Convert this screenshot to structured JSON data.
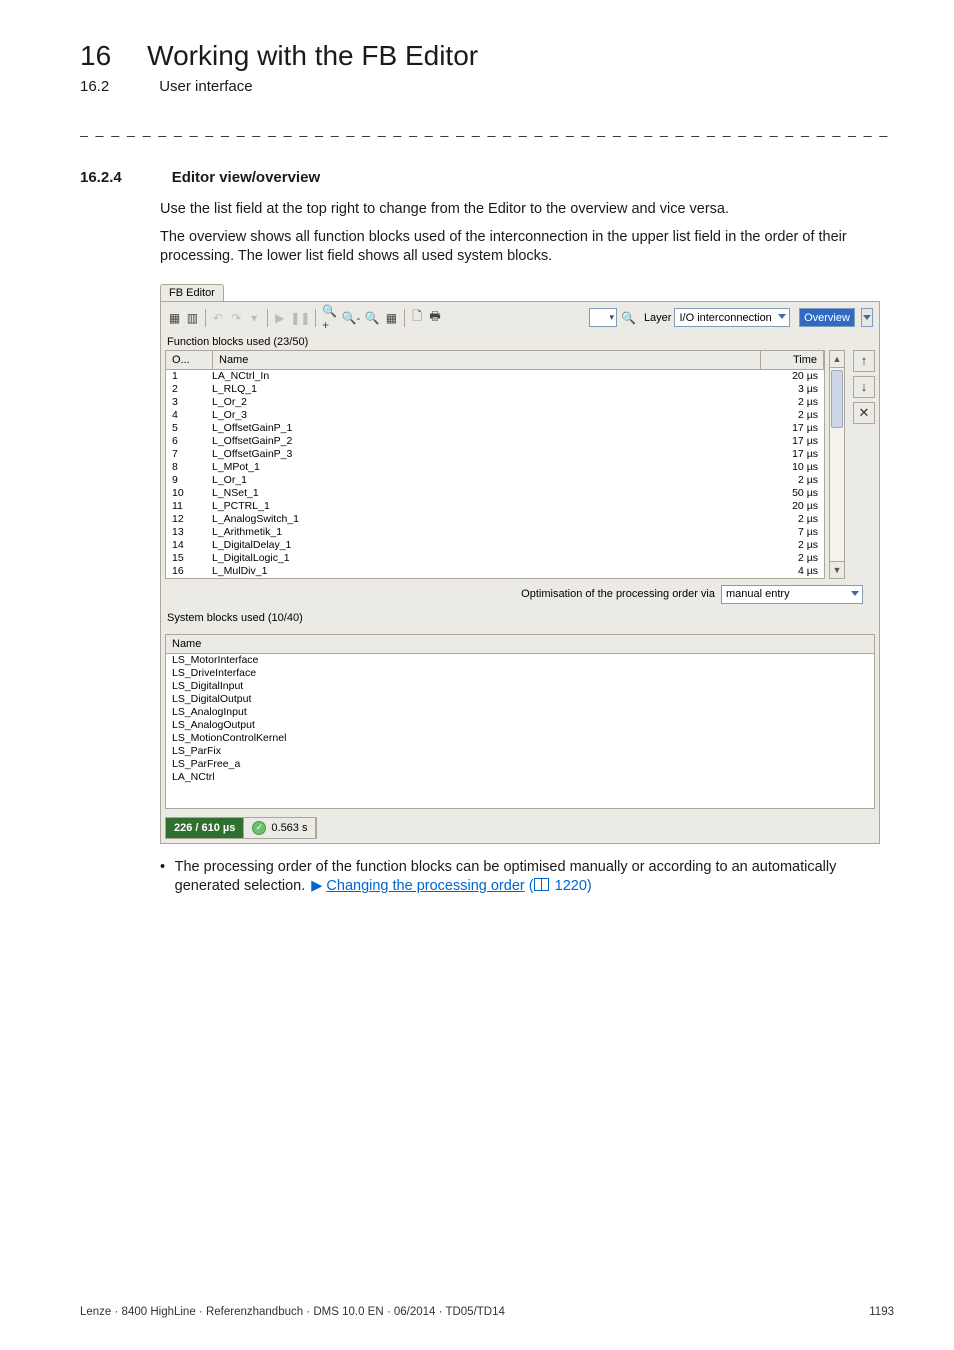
{
  "chapter": {
    "num": "16",
    "title": "Working with the FB Editor"
  },
  "subchapter": {
    "num": "16.2",
    "title": "User interface"
  },
  "divider": "_ _ _ _ _ _ _ _ _ _ _ _ _ _ _ _ _ _ _ _ _ _ _ _ _ _ _ _ _ _ _ _ _ _ _ _ _ _ _ _ _ _ _ _ _ _ _ _ _ _ _ _ _ _ _ _ _ _ _ _ _ _ _ _",
  "section": {
    "num": "16.2.4",
    "title": "Editor view/overview"
  },
  "paragraphs": {
    "p1": "Use the list field at the top right to change from the Editor to the overview and vice versa.",
    "p2": "The overview shows all function blocks used of the interconnection in the upper list field in the order of their processing. The lower list field shows all used system blocks."
  },
  "shot": {
    "tab": "FB Editor",
    "layer_label": "Layer",
    "layer_value": "I/O interconnection",
    "view_value": "Overview",
    "fb_caption": "Function blocks used (23/50)",
    "headers": {
      "order": "O...",
      "name": "Name",
      "time": "Time"
    },
    "rows": [
      {
        "o": "1",
        "n": "LA_NCtrl_In",
        "t": "20 µs"
      },
      {
        "o": "2",
        "n": "L_RLQ_1",
        "t": "3 µs"
      },
      {
        "o": "3",
        "n": "L_Or_2",
        "t": "2 µs"
      },
      {
        "o": "4",
        "n": "L_Or_3",
        "t": "2 µs"
      },
      {
        "o": "5",
        "n": "L_OffsetGainP_1",
        "t": "17 µs"
      },
      {
        "o": "6",
        "n": "L_OffsetGainP_2",
        "t": "17 µs"
      },
      {
        "o": "7",
        "n": "L_OffsetGainP_3",
        "t": "17 µs"
      },
      {
        "o": "8",
        "n": "L_MPot_1",
        "t": "10 µs"
      },
      {
        "o": "9",
        "n": "L_Or_1",
        "t": "2 µs"
      },
      {
        "o": "10",
        "n": "L_NSet_1",
        "t": "50 µs"
      },
      {
        "o": "11",
        "n": "L_PCTRL_1",
        "t": "20 µs"
      },
      {
        "o": "12",
        "n": "L_AnalogSwitch_1",
        "t": "2 µs"
      },
      {
        "o": "13",
        "n": "L_Arithmetik_1",
        "t": "7 µs"
      },
      {
        "o": "14",
        "n": "L_DigitalDelay_1",
        "t": "2 µs"
      },
      {
        "o": "15",
        "n": "L_DigitalLogic_1",
        "t": "2 µs"
      },
      {
        "o": "16",
        "n": "L_MulDiv_1",
        "t": "4 µs"
      }
    ],
    "opt_label": "Optimisation of the processing order via",
    "opt_value": "manual entry",
    "sb_caption": "System blocks used (10/40)",
    "sb_header": "Name",
    "sb_rows": [
      "LS_MotorInterface",
      "LS_DriveInterface",
      "LS_DigitalInput",
      "LS_DigitalOutput",
      "LS_AnalogInput",
      "LS_AnalogOutput",
      "LS_MotionControlKernel",
      "LS_ParFix",
      "LS_ParFree_a",
      "LA_NCtrl"
    ],
    "status": {
      "used": "226 / 610 µs",
      "time": "0.563 s"
    }
  },
  "bullet": {
    "text": "The processing order of the function blocks can be optimised manually or according to an automatically generated selection.",
    "link": "Changing the processing order",
    "pageref": "1220"
  },
  "footer": {
    "left": "Lenze · 8400 HighLine · Referenzhandbuch · DMS 10.0 EN · 06/2014 · TD05/TD14",
    "right": "1193"
  }
}
